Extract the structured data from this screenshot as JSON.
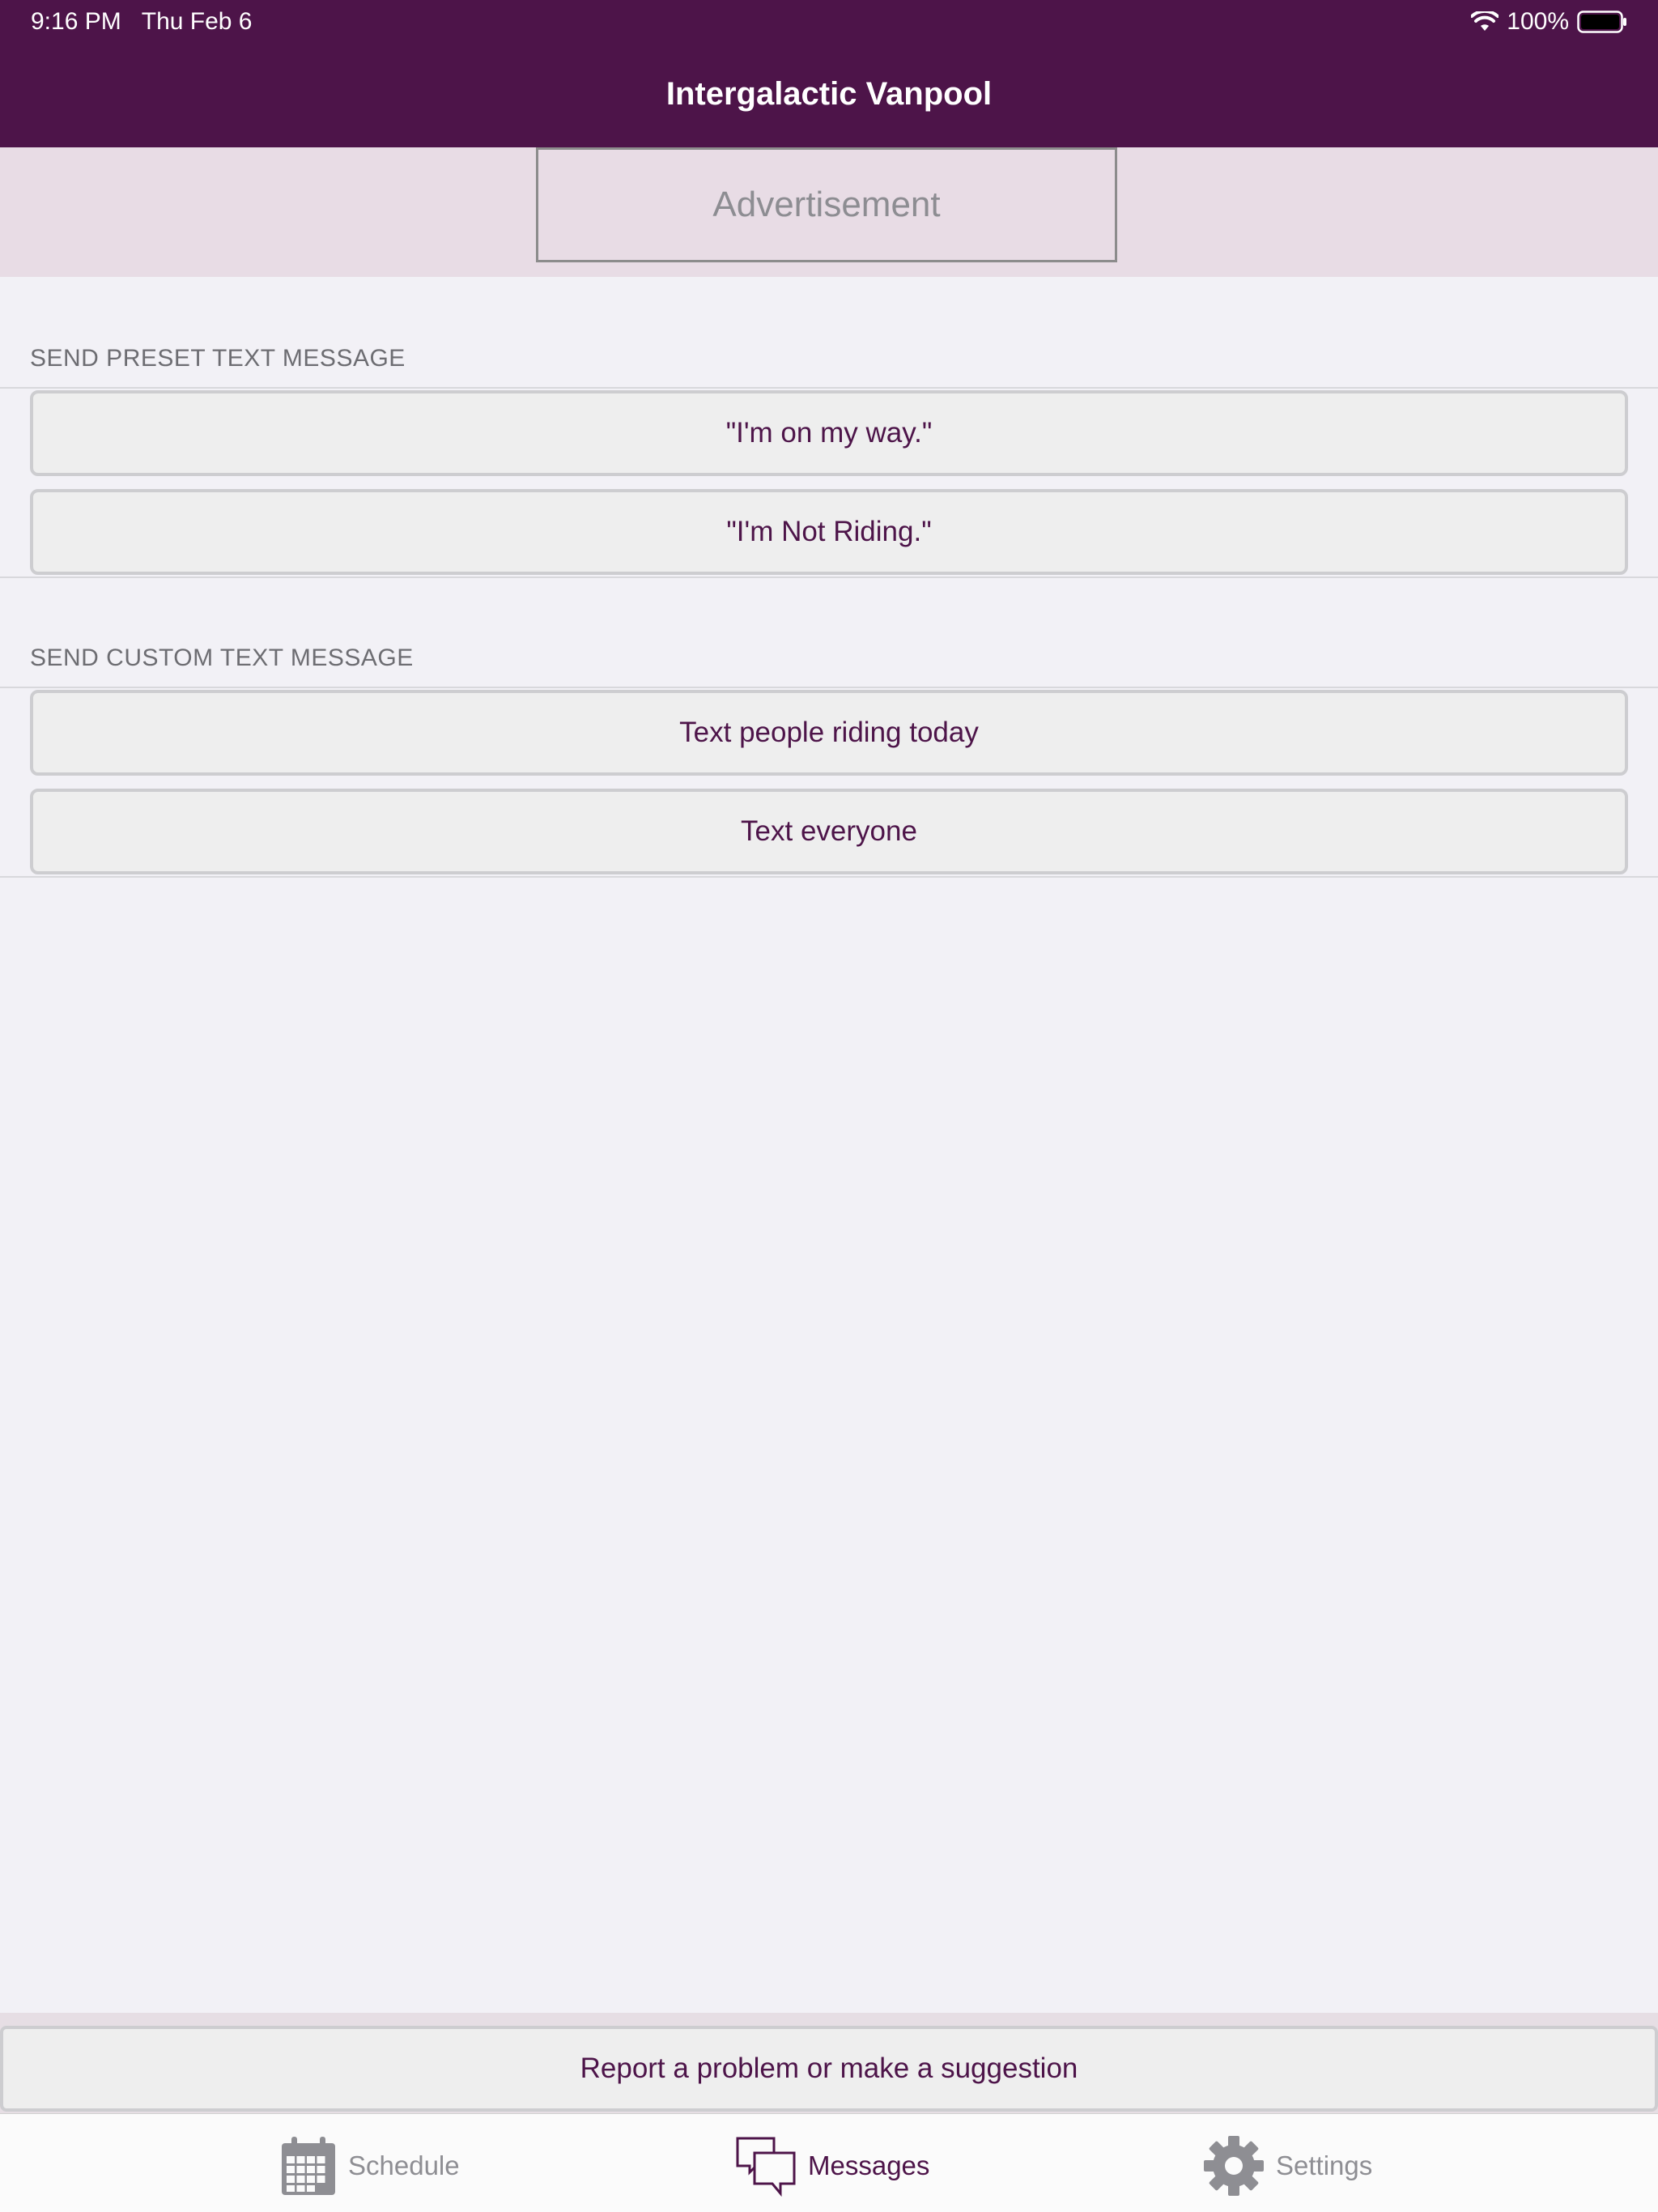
{
  "status_bar": {
    "time": "9:16 PM",
    "date": "Thu Feb 6",
    "battery": "100%",
    "wifi_icon": "wifi-icon",
    "battery_icon": "battery-full-icon"
  },
  "nav": {
    "title": "Intergalactic Vanpool"
  },
  "ad": {
    "label": "Advertisement"
  },
  "preset_section": {
    "header": "SEND PRESET TEXT MESSAGE",
    "buttons": [
      {
        "label": "\"I'm on my way.\""
      },
      {
        "label": "\"I'm Not Riding.\""
      }
    ]
  },
  "custom_section": {
    "header": "SEND CUSTOM TEXT MESSAGE",
    "buttons": [
      {
        "label": "Text people riding today"
      },
      {
        "label": "Text everyone"
      }
    ]
  },
  "report": {
    "label": "Report a problem or make a suggestion"
  },
  "tabs": [
    {
      "label": "Schedule",
      "icon": "calendar-icon",
      "selected": false
    },
    {
      "label": "Messages",
      "icon": "chat-bubbles-icon",
      "selected": true
    },
    {
      "label": "Settings",
      "icon": "gear-icon",
      "selected": false
    }
  ],
  "colors": {
    "brand": "#4d1449",
    "ad_background": "#e8dce5",
    "page_background": "#f2f1f6",
    "tab_inactive": "#8e8e93"
  }
}
